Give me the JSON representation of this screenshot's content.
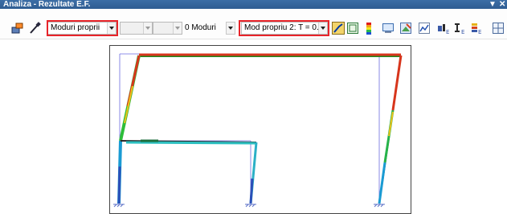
{
  "window": {
    "title": "Analiza - Rezultate E.F.",
    "menu_glyph": "▼",
    "close_glyph": "✕"
  },
  "toolbar": {
    "mode_combo": {
      "value": "Moduri proprii",
      "options_open": false
    },
    "disabled_combo_1": {
      "value": ""
    },
    "disabled_combo_2": {
      "value": ""
    },
    "modes_count_combo": {
      "value": "0 Moduri"
    },
    "mode_select_combo": {
      "value": "Mod propriu 2: T = 0."
    },
    "icons": [
      "model-view-icon",
      "pipette-icon",
      "deformed-shape-icon",
      "zoom-frame-icon",
      "color-scale-icon",
      "display-options-icon",
      "export-image-icon",
      "graph-icon",
      "beam-force-icon",
      "section-force-icon",
      "element-result-icon",
      "window-layout-icon"
    ]
  },
  "accent_colors": {
    "highlight": "#e8242a",
    "title_bar": "#2f5d92"
  },
  "canvas": {
    "content": "deformed frame - mode shape"
  }
}
